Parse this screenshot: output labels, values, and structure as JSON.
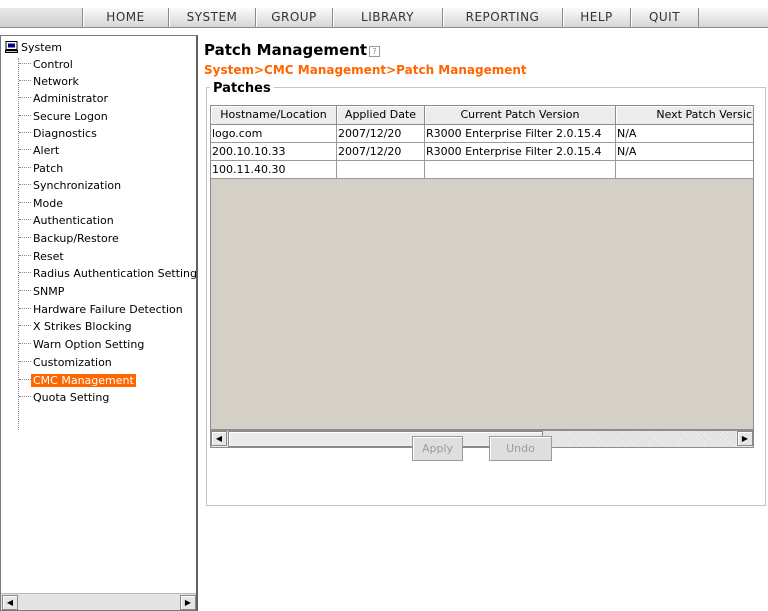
{
  "menu": {
    "items": [
      {
        "label": "HOME"
      },
      {
        "label": "SYSTEM"
      },
      {
        "label": "GROUP"
      },
      {
        "label": "LIBRARY"
      },
      {
        "label": "REPORTING"
      },
      {
        "label": "HELP"
      },
      {
        "label": "QUIT"
      }
    ]
  },
  "sidebar": {
    "root_label": "System",
    "root_icon": "computer-icon",
    "items": [
      {
        "label": "Control"
      },
      {
        "label": "Network"
      },
      {
        "label": "Administrator"
      },
      {
        "label": "Secure Logon"
      },
      {
        "label": "Diagnostics"
      },
      {
        "label": "Alert"
      },
      {
        "label": "Patch"
      },
      {
        "label": "Synchronization"
      },
      {
        "label": "Mode"
      },
      {
        "label": "Authentication"
      },
      {
        "label": "Backup/Restore"
      },
      {
        "label": "Reset"
      },
      {
        "label": "Radius Authentication Setting"
      },
      {
        "label": "SNMP"
      },
      {
        "label": "Hardware Failure Detection"
      },
      {
        "label": "X Strikes Blocking"
      },
      {
        "label": "Warn Option Setting"
      },
      {
        "label": "Customization"
      },
      {
        "label": "CMC Management",
        "selected": true
      },
      {
        "label": "Quota Setting"
      }
    ],
    "selected_color": "#ff6600"
  },
  "main": {
    "title": "Patch Management",
    "help_icon": "?",
    "breadcrumb": "System>CMC Management>Patch Management",
    "breadcrumb_color": "#ff6600",
    "section_label": "Patches",
    "table": {
      "columns": [
        "Hostname/Location",
        "Applied Date",
        "Current Patch Version",
        "Next Patch Versic"
      ],
      "rows": [
        [
          "logo.com",
          "2007/12/20",
          "R3000 Enterprise Filter 2.0.15.4",
          "N/A"
        ],
        [
          "200.10.10.33",
          "2007/12/20",
          "R3000 Enterprise Filter 2.0.15.4",
          "N/A"
        ],
        [
          "100.11.40.30",
          "",
          "",
          ""
        ]
      ]
    },
    "buttons": {
      "apply": "Apply",
      "undo": "Undo"
    }
  }
}
